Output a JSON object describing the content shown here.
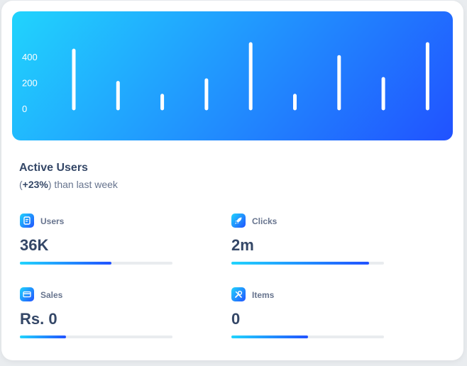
{
  "chart_data": {
    "type": "bar",
    "y_ticks": [
      "400",
      "200",
      "0"
    ],
    "values": [
      450,
      200,
      100,
      220,
      500,
      100,
      400,
      230,
      500
    ],
    "ylim": [
      0,
      500
    ]
  },
  "card": {
    "title": "Active Users",
    "subtitle_change": "+23%",
    "subtitle_open": "(",
    "subtitle_rest": ") than last week"
  },
  "stats": [
    {
      "label": "Users",
      "value": "36K",
      "progress": 0.6,
      "icon": "document-icon"
    },
    {
      "label": "Clicks",
      "value": "2m",
      "progress": 0.9,
      "icon": "rocket-icon"
    },
    {
      "label": "Sales",
      "value": "Rs. 0",
      "progress": 0.3,
      "icon": "credit-card-icon"
    },
    {
      "label": "Items",
      "value": "0",
      "progress": 0.5,
      "icon": "wrench-icon"
    }
  ],
  "colors": {
    "gradient_start": "#21d4fd",
    "gradient_end": "#2152ff",
    "text_dark": "#344767",
    "text_muted": "#67748e"
  }
}
